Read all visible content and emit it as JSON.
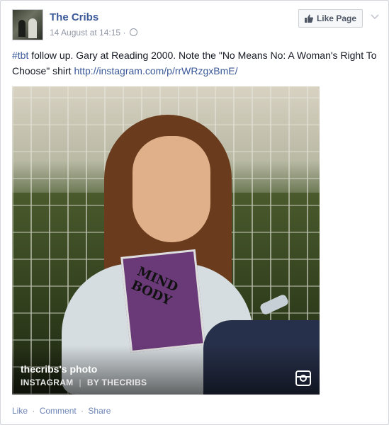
{
  "post": {
    "page_name": "The Cribs",
    "timestamp": "14 August at 14:15",
    "meta_separator": "·",
    "like_page_label": "Like Page",
    "text": {
      "hashtag": "#tbt",
      "body": " follow up. Gary at Reading 2000. Note the \"No Means No: A Woman's Right To Choose\" shirt ",
      "link": "http://instagram.com/p/rrWRzgxBmE/"
    }
  },
  "photo": {
    "title": "thecribs's photo",
    "source": "INSTAGRAM",
    "separator": "|",
    "byline": "BY THECRIBS",
    "print_text": "MIND BODY"
  },
  "actions": {
    "like": "Like",
    "comment": "Comment",
    "share": "Share",
    "separator": "·"
  },
  "colors": {
    "link_blue": "#3b5998",
    "muted_text": "#9197a3",
    "action_blue": "#6d84b4"
  },
  "icons": {
    "avatar": "page-avatar",
    "like_button": "thumbs-up-icon",
    "menu": "chevron-down-icon",
    "privacy": "globe-icon",
    "instagram": "instagram-icon"
  }
}
